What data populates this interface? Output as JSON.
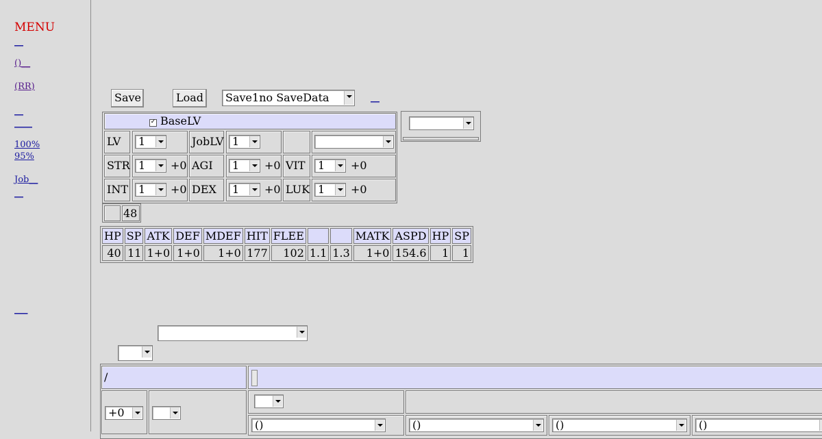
{
  "menu": {
    "title": "MENU",
    "links": [
      "__",
      "()__",
      "(RR)",
      "__",
      "____",
      "100%",
      "95%",
      "Job__",
      "__",
      "___"
    ]
  },
  "toolbar": {
    "save_label": "Save",
    "load_label": "Load",
    "save_slot": "Save1no SaveData",
    "extra_link": "__"
  },
  "status": {
    "header_label": "BaseLV",
    "lv_label": "LV",
    "lv_value": "1",
    "joblv_label": "JobLV",
    "joblv_value": "1",
    "job_select": "",
    "side_select": "",
    "rows": [
      [
        {
          "label": "STR",
          "value": "1",
          "bonus": "+0"
        },
        {
          "label": "AGI",
          "value": "1",
          "bonus": "+0"
        },
        {
          "label": "VIT",
          "value": "1",
          "bonus": "+0"
        }
      ],
      [
        {
          "label": "INT",
          "value": "1",
          "bonus": "+0"
        },
        {
          "label": "DEX",
          "value": "1",
          "bonus": "+0"
        },
        {
          "label": "LUK",
          "value": "1",
          "bonus": "+0"
        }
      ]
    ],
    "points_label": "",
    "points_value": "48"
  },
  "stats": {
    "headers": [
      "HP",
      "SP",
      "ATK",
      "DEF",
      "MDEF",
      "HIT",
      "FLEE",
      "",
      "",
      "MATK",
      "ASPD",
      "HP",
      "SP"
    ],
    "values": [
      "40",
      "11",
      "1+0",
      "1+0",
      "1+0",
      "177",
      "102",
      "1.1",
      "1.3",
      "1+0",
      "154.6",
      "1",
      "1"
    ]
  },
  "equipment": {
    "wide_select": "",
    "small_select": "",
    "header_left": "/",
    "refine": "+0",
    "card_select": "",
    "slot_select": "",
    "slots": [
      "()",
      "()",
      "()",
      "()"
    ]
  },
  "colors": {
    "background": "#dcdcdc",
    "header_fill": "#dcdcfa",
    "menu_title": "#d40000",
    "link": "#1a1aa0"
  }
}
